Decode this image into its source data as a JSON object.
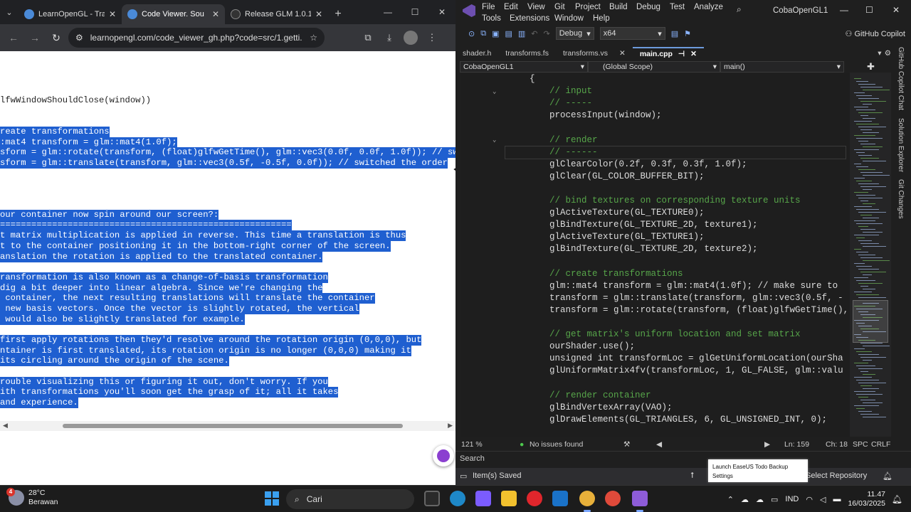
{
  "browser": {
    "tabs": [
      {
        "title": "LearnOpenGL - Tra",
        "icon": "learnopengl-favicon"
      },
      {
        "title": "Code Viewer. Sou",
        "icon": "learnopengl-favicon"
      },
      {
        "title": "Release GLM 1.0.1",
        "icon": "github-favicon"
      }
    ],
    "url": "learnopengl.com/code_viewer_gh.php?code=src/1.getti...",
    "code_lines": [
      {
        "text": "lfwWindowShouldClose(window))",
        "selected": false
      },
      {
        "text": "",
        "selected": true
      },
      {
        "text": "reate transformations",
        "selected": true
      },
      {
        "text": ":mat4 transform = glm::mat4(1.0f);",
        "selected": true
      },
      {
        "text": "sform = glm::rotate(transform, (float)glfwGetTime(), glm::vec3(0.0f, 0.0f, 1.0f)); // switched",
        "selected": true
      },
      {
        "text": "sform = glm::translate(transform, glm::vec3(0.5f, -0.5f, 0.0f)); // switched the order",
        "selected": true
      },
      {
        "text": "",
        "selected": true
      },
      {
        "text": "our container now spin around our screen?:",
        "selected": true
      },
      {
        "text": "========================================================",
        "selected": true
      },
      {
        "text": "t matrix multiplication is applied in reverse. This time a translation is thus",
        "selected": true
      },
      {
        "text": "t to the container positioning it in the bottom-right corner of the screen.",
        "selected": true
      },
      {
        "text": "anslation the rotation is applied to the translated container.",
        "selected": true
      },
      {
        "text": "ransformation is also known as a change-of-basis transformation",
        "selected": true
      },
      {
        "text": "dig a bit deeper into linear algebra. Since we're changing the",
        "selected": true
      },
      {
        "text": " container, the next resulting translations will translate the container",
        "selected": true
      },
      {
        "text": " new basis vectors. Once the vector is slightly rotated, the vertical",
        "selected": true
      },
      {
        "text": " would also be slightly translated for example.",
        "selected": true
      },
      {
        "text": "first apply rotations then they'd resolve around the rotation origin (0,0,0), but",
        "selected": true
      },
      {
        "text": "ntainer is first translated, its rotation origin is no longer (0,0,0) making it",
        "selected": true
      },
      {
        "text": "its circling around the origin of the scene.",
        "selected": true
      },
      {
        "text": "rouble visualizing this or figuring it out, don't worry. If you",
        "selected": true
      },
      {
        "text": "ith transformations you'll soon get the grasp of it; all it takes",
        "selected": true
      },
      {
        "text": "and experience.",
        "selected": true
      }
    ]
  },
  "vs": {
    "menu": [
      "File",
      "Edit",
      "View",
      "Git",
      "Project",
      "Build",
      "Debug",
      "Test",
      "Analyze",
      "Tools",
      "Extensions",
      "Window",
      "Help"
    ],
    "solution_name": "CobaOpenGL1",
    "config": "Debug",
    "platform": "x64",
    "copilot_label": "GitHub Copilot",
    "doc_tabs": [
      {
        "name": "shader.h",
        "active": false
      },
      {
        "name": "transforms.fs",
        "active": false
      },
      {
        "name": "transforms.vs",
        "active": false
      },
      {
        "name": "main.cpp",
        "active": true
      }
    ],
    "nav": {
      "project": "CobaOpenGL1",
      "scope": "(Global Scope)",
      "member": "main()"
    },
    "code_lines": [
      {
        "text": "{",
        "indent": 0,
        "comment": false
      },
      {
        "text": "// input",
        "indent": 1,
        "comment": true
      },
      {
        "text": "// -----",
        "indent": 1,
        "comment": true
      },
      {
        "text": "processInput(window);",
        "indent": 1,
        "comment": false
      },
      {
        "text": "",
        "indent": 1,
        "comment": false
      },
      {
        "text": "// render",
        "indent": 1,
        "comment": true
      },
      {
        "text": "// ------",
        "indent": 1,
        "comment": true
      },
      {
        "text": "glClearColor(0.2f, 0.3f, 0.3f, 1.0f);",
        "indent": 1,
        "comment": false
      },
      {
        "text": "glClear(GL_COLOR_BUFFER_BIT);",
        "indent": 1,
        "comment": false
      },
      {
        "text": "",
        "indent": 1,
        "comment": false
      },
      {
        "text": "// bind textures on corresponding texture units",
        "indent": 1,
        "comment": true
      },
      {
        "text": "glActiveTexture(GL_TEXTURE0);",
        "indent": 1,
        "comment": false
      },
      {
        "text": "glBindTexture(GL_TEXTURE_2D, texture1);",
        "indent": 1,
        "comment": false
      },
      {
        "text": "glActiveTexture(GL_TEXTURE1);",
        "indent": 1,
        "comment": false
      },
      {
        "text": "glBindTexture(GL_TEXTURE_2D, texture2);",
        "indent": 1,
        "comment": false
      },
      {
        "text": "",
        "indent": 1,
        "comment": false
      },
      {
        "text": "// create transformations",
        "indent": 1,
        "comment": true
      },
      {
        "text": "glm::mat4 transform = glm::mat4(1.0f); // make sure to",
        "indent": 1,
        "comment": false
      },
      {
        "text": "transform = glm::translate(transform, glm::vec3(0.5f, -",
        "indent": 1,
        "comment": false
      },
      {
        "text": "transform = glm::rotate(transform, (float)glfwGetTime(),",
        "indent": 1,
        "comment": false
      },
      {
        "text": "",
        "indent": 1,
        "comment": false
      },
      {
        "text": "// get matrix's uniform location and set matrix",
        "indent": 1,
        "comment": true
      },
      {
        "text": "ourShader.use();",
        "indent": 1,
        "comment": false
      },
      {
        "text": "unsigned int transformLoc = glGetUniformLocation(ourSha",
        "indent": 1,
        "comment": false
      },
      {
        "text": "glUniformMatrix4fv(transformLoc, 1, GL_FALSE, glm::valu",
        "indent": 1,
        "comment": false
      },
      {
        "text": "",
        "indent": 1,
        "comment": false
      },
      {
        "text": "// render container",
        "indent": 1,
        "comment": true
      },
      {
        "text": "glBindVertexArray(VAO);",
        "indent": 1,
        "comment": false
      },
      {
        "text": "glDrawElements(GL_TRIANGLES, 6, GL_UNSIGNED_INT, 0);",
        "indent": 1,
        "comment": false
      }
    ],
    "side_panels": [
      "GitHub Copilot Chat",
      "Solution Explorer",
      "Git Changes"
    ],
    "editor_status": {
      "zoom": "121 %",
      "issues": "No issues found",
      "line": "Ln: 159",
      "col": "Ch: 18",
      "whitespace": "SPC",
      "eol": "CRLF"
    },
    "output_label": "Search",
    "status": {
      "message": "Item(s) Saved",
      "repo": "Select Repository"
    }
  },
  "toast": {
    "line1": "Launch EaseUS Todo Backup",
    "line2": "Settings"
  },
  "taskbar": {
    "weather": {
      "temp": "28°C",
      "desc": "Berawan",
      "badge": "4"
    },
    "search_placeholder": "Cari",
    "lang": "IND",
    "time": "11.47",
    "date": "16/03/2025"
  }
}
